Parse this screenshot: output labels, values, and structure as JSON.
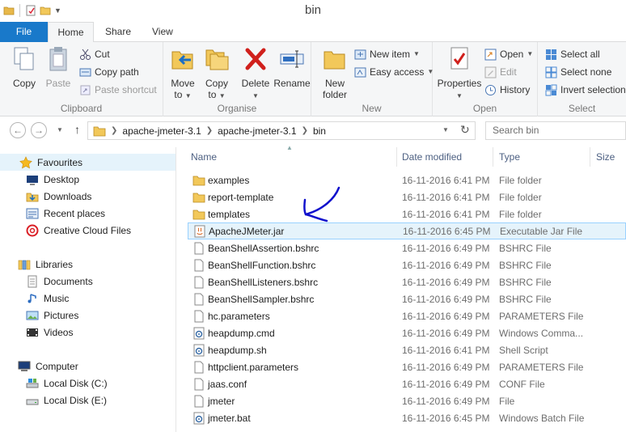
{
  "window": {
    "title": "bin"
  },
  "ribbon_tabs": {
    "file": "File",
    "home": "Home",
    "share": "Share",
    "view": "View"
  },
  "clipboard": {
    "copy": "Copy",
    "paste": "Paste",
    "cut": "Cut",
    "copy_path": "Copy path",
    "paste_shortcut": "Paste shortcut",
    "label": "Clipboard"
  },
  "organise": {
    "move_to": "Move",
    "move_to_2": "to",
    "copy_to": "Copy",
    "copy_to_2": "to",
    "delete": "Delete",
    "rename": "Rename",
    "label": "Organise"
  },
  "new_group": {
    "new_folder": "New",
    "new_folder_2": "folder",
    "new_item": "New item",
    "easy_access": "Easy access",
    "label": "New"
  },
  "open_group": {
    "properties": "Properties",
    "open": "Open",
    "edit": "Edit",
    "history": "History",
    "label": "Open"
  },
  "select_group": {
    "select_all": "Select all",
    "select_none": "Select none",
    "invert_selection": "Invert selection",
    "label": "Select"
  },
  "address": {
    "crumbs": [
      "apache-jmeter-3.1",
      "apache-jmeter-3.1",
      "bin"
    ],
    "search_placeholder": "Search bin"
  },
  "nav_pane": {
    "favourites": "Favourites",
    "desktop": "Desktop",
    "downloads": "Downloads",
    "recent_places": "Recent places",
    "creative_cloud": "Creative Cloud Files",
    "libraries": "Libraries",
    "documents": "Documents",
    "music": "Music",
    "pictures": "Pictures",
    "videos": "Videos",
    "computer": "Computer",
    "local_c": "Local Disk (C:)",
    "local_e": "Local Disk (E:)"
  },
  "columns": {
    "name": "Name",
    "date": "Date modified",
    "type": "Type",
    "size": "Size"
  },
  "files": [
    {
      "name": "examples",
      "date": "16-11-2016 6:41 PM",
      "type": "File folder",
      "icon": "folder-icon"
    },
    {
      "name": "report-template",
      "date": "16-11-2016 6:41 PM",
      "type": "File folder",
      "icon": "folder-icon"
    },
    {
      "name": "templates",
      "date": "16-11-2016 6:41 PM",
      "type": "File folder",
      "icon": "folder-icon"
    },
    {
      "name": "ApacheJMeter.jar",
      "date": "16-11-2016 6:45 PM",
      "type": "Executable Jar File",
      "icon": "jar-icon"
    },
    {
      "name": "BeanShellAssertion.bshrc",
      "date": "16-11-2016 6:49 PM",
      "type": "BSHRC File",
      "icon": "file-icon"
    },
    {
      "name": "BeanShellFunction.bshrc",
      "date": "16-11-2016 6:49 PM",
      "type": "BSHRC File",
      "icon": "file-icon"
    },
    {
      "name": "BeanShellListeners.bshrc",
      "date": "16-11-2016 6:49 PM",
      "type": "BSHRC File",
      "icon": "file-icon"
    },
    {
      "name": "BeanShellSampler.bshrc",
      "date": "16-11-2016 6:49 PM",
      "type": "BSHRC File",
      "icon": "file-icon"
    },
    {
      "name": "hc.parameters",
      "date": "16-11-2016 6:49 PM",
      "type": "PARAMETERS File",
      "icon": "file-icon"
    },
    {
      "name": "heapdump.cmd",
      "date": "16-11-2016 6:49 PM",
      "type": "Windows Comma...",
      "icon": "script-icon"
    },
    {
      "name": "heapdump.sh",
      "date": "16-11-2016 6:41 PM",
      "type": "Shell Script",
      "icon": "script-icon"
    },
    {
      "name": "httpclient.parameters",
      "date": "16-11-2016 6:49 PM",
      "type": "PARAMETERS File",
      "icon": "file-icon"
    },
    {
      "name": "jaas.conf",
      "date": "16-11-2016 6:49 PM",
      "type": "CONF File",
      "icon": "file-icon"
    },
    {
      "name": "jmeter",
      "date": "16-11-2016 6:49 PM",
      "type": "File",
      "icon": "file-icon"
    },
    {
      "name": "jmeter.bat",
      "date": "16-11-2016 6:45 PM",
      "type": "Windows Batch File",
      "icon": "script-icon"
    }
  ],
  "colors": {
    "accent": "#1979ca",
    "selection": "#e5f3fb",
    "selection_border": "#99d1ff",
    "annotation": "#1111cc"
  }
}
